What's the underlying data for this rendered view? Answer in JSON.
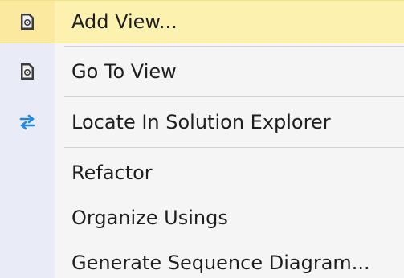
{
  "menu": {
    "items": [
      {
        "label": "Add View...",
        "icon": "document-view-icon"
      },
      {
        "label": "Go To View",
        "icon": "document-view-icon"
      },
      {
        "label": "Locate In Solution Explorer",
        "icon": "sync-arrows-icon"
      },
      {
        "label": "Refactor"
      },
      {
        "label": "Organize Usings"
      },
      {
        "label": "Generate Sequence Diagram..."
      }
    ]
  },
  "colors": {
    "background": "#f5f5f5",
    "gutter": "#e9ebf6",
    "highlight": "#fdf1b0",
    "separator": "#cfd2dc",
    "icon_dark": "#3c3c3c",
    "icon_blue": "#1e88e5"
  }
}
